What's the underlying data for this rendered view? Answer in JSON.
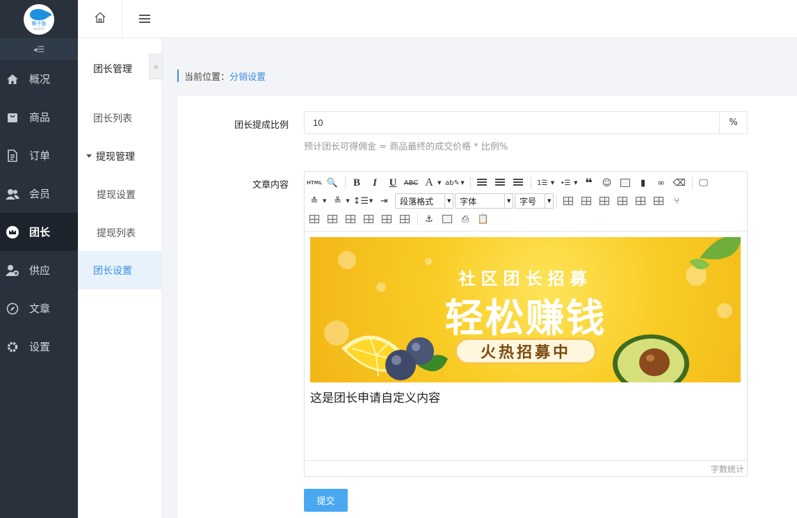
{
  "app": {
    "logo_text": "狮子鱼",
    "logo_sub": "SHIZIYU"
  },
  "sidebar": {
    "items": [
      {
        "label": "概况",
        "icon": "home-icon"
      },
      {
        "label": "商品",
        "icon": "bag-icon"
      },
      {
        "label": "订单",
        "icon": "document-icon"
      },
      {
        "label": "会员",
        "icon": "users-icon"
      },
      {
        "label": "团长",
        "icon": "crown-icon",
        "active": true
      },
      {
        "label": "供应",
        "icon": "supplier-icon"
      },
      {
        "label": "文章",
        "icon": "compass-icon"
      },
      {
        "label": "设置",
        "icon": "gear-icon"
      }
    ]
  },
  "subnav": {
    "title": "团长管理",
    "items": [
      {
        "label": "团长列表"
      },
      {
        "label": "提现管理"
      },
      {
        "label": "提现设置"
      },
      {
        "label": "提现列表"
      },
      {
        "label": "团长设置",
        "active": true
      }
    ]
  },
  "breadcrumb": {
    "prefix": "当前位置：",
    "current": "分销设置"
  },
  "form": {
    "rate_label": "团长提成比例",
    "rate_value": "10",
    "rate_unit": "%",
    "rate_hint": "预计团长可得佣金 = 商品最终的成交价格 * 比例%",
    "content_label": "文章内容",
    "submit_label": "提交"
  },
  "editor": {
    "paragraph_select": "段落格式",
    "font_select": "字体",
    "size_select": "字号",
    "word_count": "字数统计",
    "banner_line1": "社区团长招募",
    "banner_line2": "轻松赚钱",
    "banner_badge": "火热招募中",
    "body_text": "这是团长申请自定义内容"
  },
  "colors": {
    "accent": "#3a8ee6",
    "sidebar_bg": "#28313c",
    "submit_bg": "#4aa8f0",
    "banner_yellow": "#f9cc25"
  }
}
